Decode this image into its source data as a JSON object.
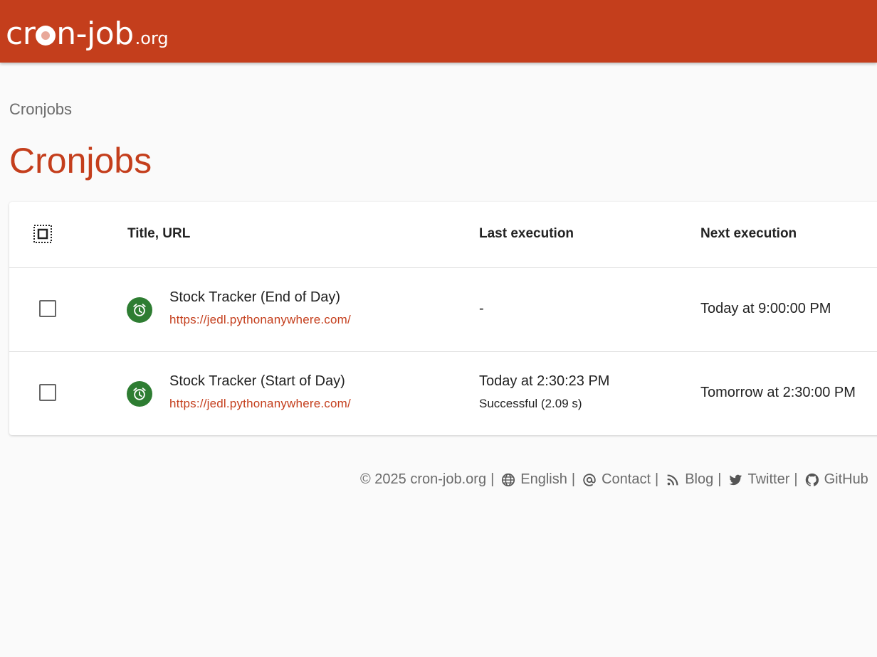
{
  "colors": {
    "brand": "#c43e1c",
    "success": "#2e7d32",
    "background": "#fafafa"
  },
  "header": {
    "logo_main_prefix": "cr",
    "logo_main_suffix": "n-job",
    "logo_tld": ".org"
  },
  "breadcrumb": "Cronjobs",
  "page_title": "Cronjobs",
  "table": {
    "columns": [
      "Title, URL",
      "Last execution",
      "Next execution"
    ],
    "rows": [
      {
        "title": "Stock Tracker (End of Day)",
        "url": "https://jedl.pythonanywhere.com/",
        "last_execution": "-",
        "last_status": "",
        "next_execution": "Today at 9:00:00 PM",
        "icon": "alarm-clock-icon"
      },
      {
        "title": "Stock Tracker (Start of Day)",
        "url": "https://jedl.pythonanywhere.com/",
        "last_execution": "Today at 2:30:23 PM",
        "last_status": "Successful (2.09 s)",
        "next_execution": "Tomorrow at 2:30:00 PM",
        "icon": "alarm-clock-icon"
      }
    ]
  },
  "footer": {
    "copyright": "© 2025 cron-job.org",
    "links": [
      {
        "label": "English",
        "icon": "globe-icon"
      },
      {
        "label": "Contact",
        "icon": "at-icon"
      },
      {
        "label": "Blog",
        "icon": "rss-icon"
      },
      {
        "label": "Twitter",
        "icon": "twitter-icon"
      },
      {
        "label": "GitHub",
        "icon": "github-icon"
      }
    ]
  }
}
